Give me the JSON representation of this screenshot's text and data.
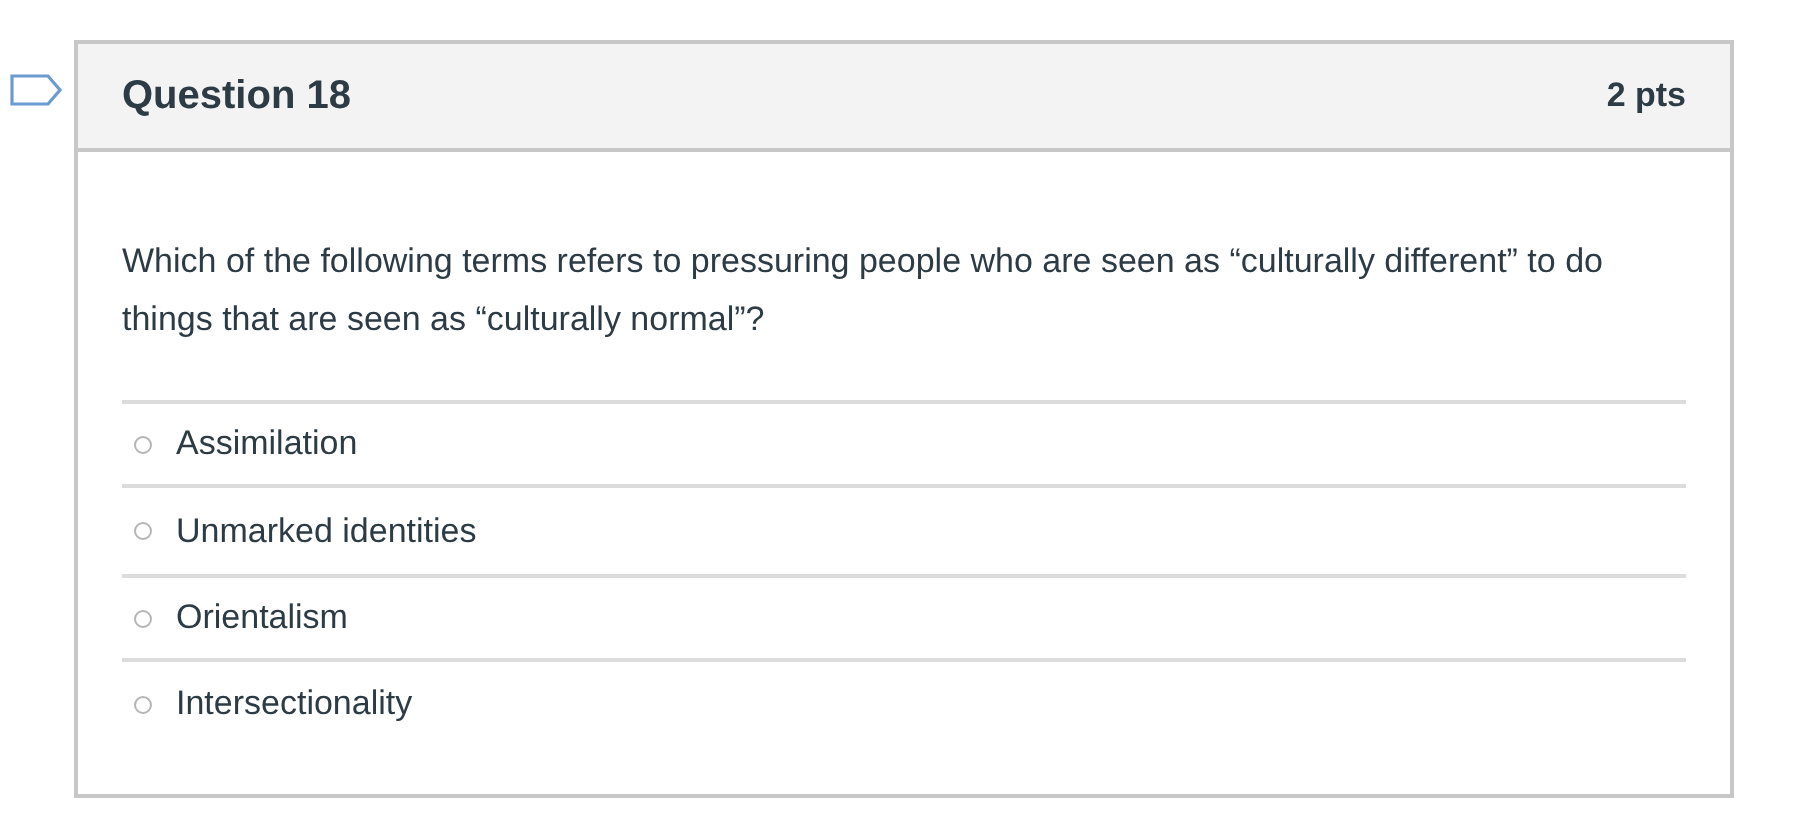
{
  "question": {
    "title": "Question 18",
    "points": "2 pts",
    "flagged": false,
    "text": "Which of the following terms refers to pressuring people who are seen as “culturally different” to do things that are seen as “culturally normal”?",
    "answers": [
      {
        "label": "Assimilation",
        "selected": false
      },
      {
        "label": "Unmarked identities",
        "selected": false
      },
      {
        "label": "Orientalism",
        "selected": false
      },
      {
        "label": "Intersectionality",
        "selected": false
      }
    ]
  }
}
